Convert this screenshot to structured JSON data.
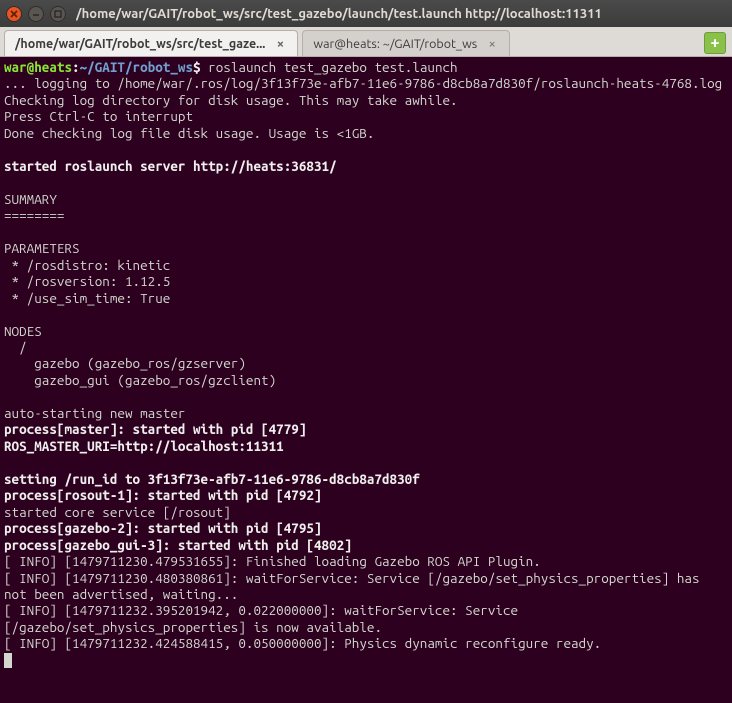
{
  "titlebar": {
    "title": "/home/war/GAIT/robot_ws/src/test_gazebo/launch/test.launch http://localhost:11311"
  },
  "tabs": [
    {
      "label": "/home/war/GAIT/robot_ws/src/test_gaze...",
      "active": true
    },
    {
      "label": "war@heats: ~/GAIT/robot_ws",
      "active": false
    }
  ],
  "prompt": {
    "user_host": "war@heats",
    "sep": ":",
    "path": "~/GAIT/robot_ws",
    "dollar": "$",
    "command": "roslaunch test_gazebo test.launch"
  },
  "lines": {
    "l01": "... logging to /home/war/.ros/log/3f13f73e-afb7-11e6-9786-d8cb8a7d830f/roslaunch-heats-4768.log",
    "l02": "Checking log directory for disk usage. This may take awhile.",
    "l03": "Press Ctrl-C to interrupt",
    "l04": "Done checking log file disk usage. Usage is <1GB.",
    "l05": "",
    "l06": "started roslaunch server http://heats:36831/",
    "l07": "",
    "l08": "SUMMARY",
    "l09": "========",
    "l10": "",
    "l11": "PARAMETERS",
    "l12": " * /rosdistro: kinetic",
    "l13": " * /rosversion: 1.12.5",
    "l14": " * /use_sim_time: True",
    "l15": "",
    "l16": "NODES",
    "l17": "  /",
    "l18": "    gazebo (gazebo_ros/gzserver)",
    "l19": "    gazebo_gui (gazebo_ros/gzclient)",
    "l20": "",
    "l21": "auto-starting new master",
    "l22": "process[master]: started with pid [4779]",
    "l23": "ROS_MASTER_URI=http://localhost:11311",
    "l24": "",
    "l25": "setting /run_id to 3f13f73e-afb7-11e6-9786-d8cb8a7d830f",
    "l26": "process[rosout-1]: started with pid [4792]",
    "l27": "started core service [/rosout]",
    "l28": "process[gazebo-2]: started with pid [4795]",
    "l29": "process[gazebo_gui-3]: started with pid [4802]",
    "l30": "[ INFO] [1479711230.479531655]: Finished loading Gazebo ROS API Plugin.",
    "l31": "[ INFO] [1479711230.480380861]: waitForService: Service [/gazebo/set_physics_properties] has not been advertised, waiting...",
    "l32": "[ INFO] [1479711232.395201942, 0.022000000]: waitForService: Service [/gazebo/set_physics_properties] is now available.",
    "l33": "[ INFO] [1479711232.424588415, 0.050000000]: Physics dynamic reconfigure ready."
  }
}
